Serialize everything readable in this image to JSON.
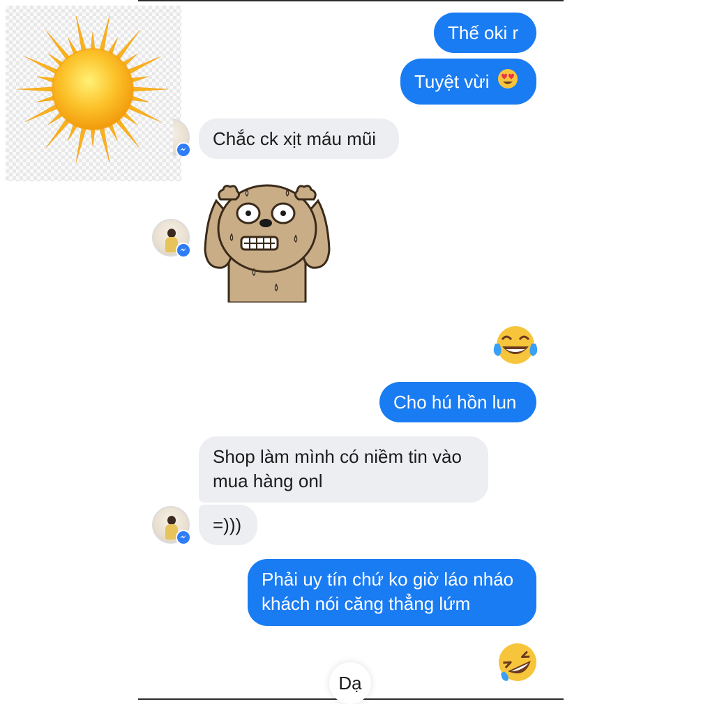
{
  "messages": {
    "out1": "Thế oki r",
    "out2": "Tuyệt vừi",
    "in1": "Chắc ck xịt máu mũi",
    "out3": "Cho hú hồn lun",
    "in2_line1": "Shop làm mình có niềm tin vào",
    "in2_line2": "mua hàng onl",
    "in3": "=)))",
    "out4_line1": "Phải uy tín chứ ko giờ láo nháo",
    "out4_line2": "khách nói căng thẳng lứm"
  },
  "quick_reply": "Dạ",
  "icons": {
    "overlay": "sun-icon",
    "sticker": "sweating-dog-sticker",
    "reaction1": "heart-eyes-emoji",
    "reaction2": "tears-of-joy-emoji",
    "reaction3": "rolling-laughing-emoji",
    "badge": "messenger-badge-icon"
  },
  "colors": {
    "outgoing_bubble": "#1a7cf2",
    "incoming_bubble": "#eceef1",
    "messenger_badge": "#2f7cf6",
    "emoji_yellow": "#f7c53b"
  }
}
